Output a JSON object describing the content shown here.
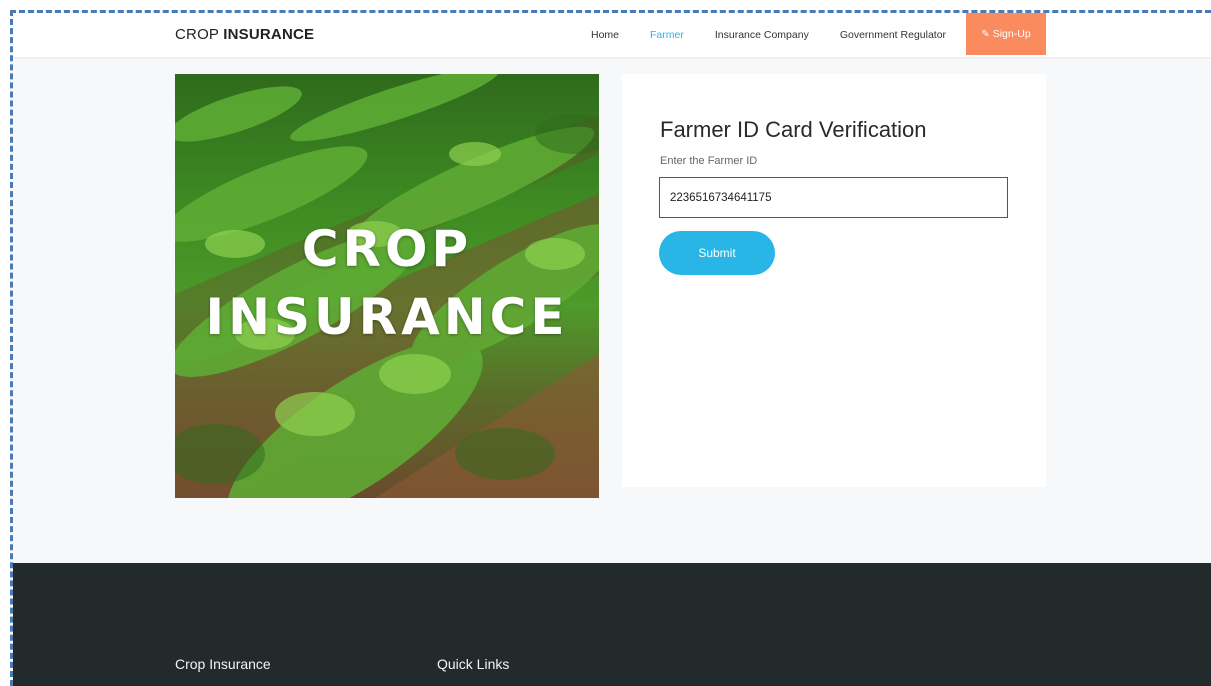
{
  "navbar": {
    "brand_light": "CROP",
    "brand_bold": "INSURANCE",
    "links": [
      {
        "label": "Home",
        "active": false
      },
      {
        "label": "Farmer",
        "active": true
      },
      {
        "label": "Insurance Company",
        "active": false
      },
      {
        "label": "Government Regulator",
        "active": false
      }
    ],
    "signup_label": "Sign-Up",
    "signup_icon": "pencil-icon",
    "signup_color": "#f98b5e",
    "accent_color": "#29b6e6"
  },
  "hero": {
    "line1": "CROP",
    "line2": "INSURANCE"
  },
  "form": {
    "title": "Farmer ID Card Verification",
    "label": "Enter the Farmer ID",
    "value": "2236516734641175",
    "submit_label": "Submit"
  },
  "footer": {
    "col1_title": "Crop Insurance",
    "col2_title": "Quick Links",
    "background": "#232a2b"
  }
}
